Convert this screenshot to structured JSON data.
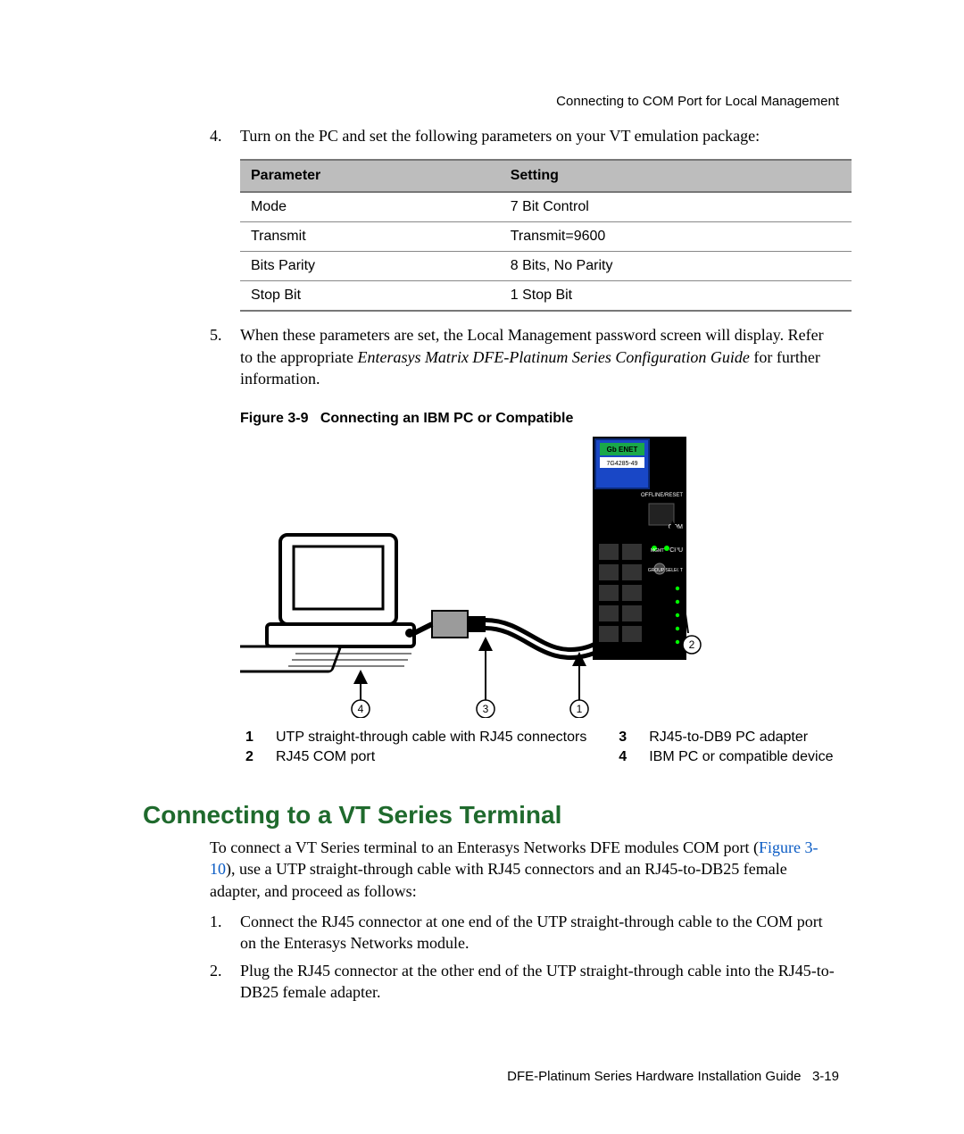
{
  "running_head": "Connecting to COM Port for Local Management",
  "step4": {
    "num": "4.",
    "text": "Turn on the PC and set the following parameters on your VT emulation package:"
  },
  "table": {
    "head_param": "Parameter",
    "head_setting": "Setting",
    "rows": [
      {
        "param": "Mode",
        "setting": "7 Bit Control"
      },
      {
        "param": "Transmit",
        "setting": "Transmit=9600"
      },
      {
        "param": "Bits Parity",
        "setting": "8 Bits, No Parity"
      },
      {
        "param": "Stop Bit",
        "setting": "1 Stop Bit"
      }
    ]
  },
  "step5": {
    "num": "5.",
    "text_a": "When these parameters are set, the Local Management password screen will display. Refer to the appropriate ",
    "text_italic": "Enterasys Matrix DFE-Platinum Series Configuration Guide",
    "text_b": " for further information."
  },
  "figure": {
    "label": "Figure 3-9",
    "title": "Connecting an IBM PC or Compatible",
    "device_label_top": "Gb ENET",
    "device_label_sub": "7G4285-49",
    "device_port_labels": {
      "com": "COM",
      "cpu": "CPU",
      "mgmt": "MGMT",
      "group": "GROUP SELECT",
      "offline": "OFFLINE/RESET"
    },
    "callouts": {
      "c1": "1",
      "c2": "2",
      "c3": "3",
      "c4": "4"
    }
  },
  "legend": {
    "i1": {
      "n": "1",
      "t": "UTP straight-through cable with RJ45 connectors"
    },
    "i2": {
      "n": "2",
      "t": "RJ45 COM port"
    },
    "i3": {
      "n": "3",
      "t": "RJ45-to-DB9 PC adapter"
    },
    "i4": {
      "n": "4",
      "t": "IBM PC or compatible device"
    }
  },
  "section_title": "Connecting to a VT Series Terminal",
  "vt_intro_a": "To connect a VT Series terminal to an Enterasys Networks DFE modules COM port (",
  "vt_intro_xref": "Figure 3-10",
  "vt_intro_b": "), use a UTP straight-through cable with RJ45 connectors and an RJ45-to-DB25 female adapter, and proceed as follows:",
  "vt_step1": {
    "num": "1.",
    "text": "Connect the RJ45 connector at one end of the UTP straight-through cable to the COM port on the Enterasys Networks module."
  },
  "vt_step2": {
    "num": "2.",
    "text": "Plug the RJ45 connector at the other end of the UTP straight-through cable into the RJ45-to-DB25 female adapter."
  },
  "footer": {
    "guide": "DFE-Platinum Series Hardware Installation Guide",
    "page": "3-19"
  }
}
